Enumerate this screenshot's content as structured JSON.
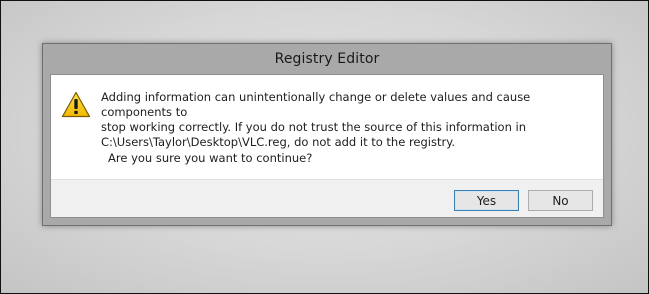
{
  "dialog": {
    "title": "Registry Editor",
    "message_line1": "Adding information can unintentionally change or delete values and cause components to",
    "message_line2": "stop working correctly. If you do not trust the source of this information in",
    "message_line3": "C:\\Users\\Taylor\\Desktop\\VLC.reg, do not add it to the registry.",
    "question": "Are you sure you want to continue?",
    "icon": "warning-icon",
    "buttons": {
      "yes_label": "Yes",
      "no_label": "No"
    }
  },
  "colors": {
    "frame": "#a9a9a9",
    "warning_yellow": "#f6c900",
    "default_button_border": "#3c7fb1"
  }
}
